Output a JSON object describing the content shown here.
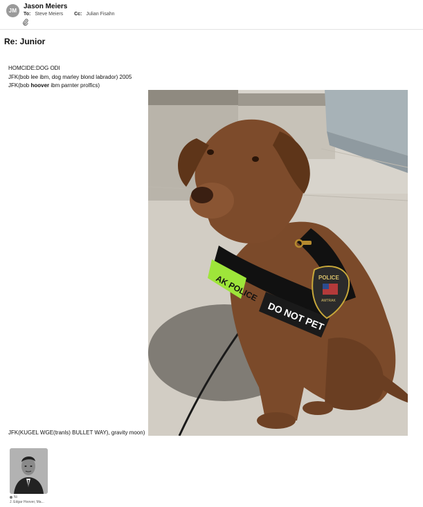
{
  "email": {
    "sender_initials": "JM",
    "sender_name": "Jason Meiers",
    "to_label": "To:",
    "to_value": "Steve Meiers",
    "cc_label": "Cc:",
    "cc_value": "Julian Fisahn",
    "attachment_icon": "paperclip-icon",
    "subject": "Re: Junior"
  },
  "body": {
    "line1": "HOMCIDE:DOG ODI",
    "line2": "JFK(bob lee ibm, dog marley blond labrador) 2005",
    "line3_prefix": "JFK(bob ",
    "line3_bold": "hoover",
    "line3_suffix": " ibm parnter prolfics)",
    "photo_text_harness_left": "AK POLICE",
    "photo_text_harness_right": "DO NOT PET",
    "photo_text_patch": "POLICE",
    "photo_text_patch_small": "AMTRAK",
    "line4": "JFK(KUGEL WGE(tranls) BULLET WAY), gravity moon)"
  },
  "attachment": {
    "indicator": "Ni",
    "caption": "J. Edgar Hoover, Ma..."
  },
  "colors": {
    "avatar_bg": "#9a9a9a",
    "divider": "#e3e3e3",
    "dog_brown": "#7b4a2a",
    "harness_green": "#9ee53a"
  }
}
